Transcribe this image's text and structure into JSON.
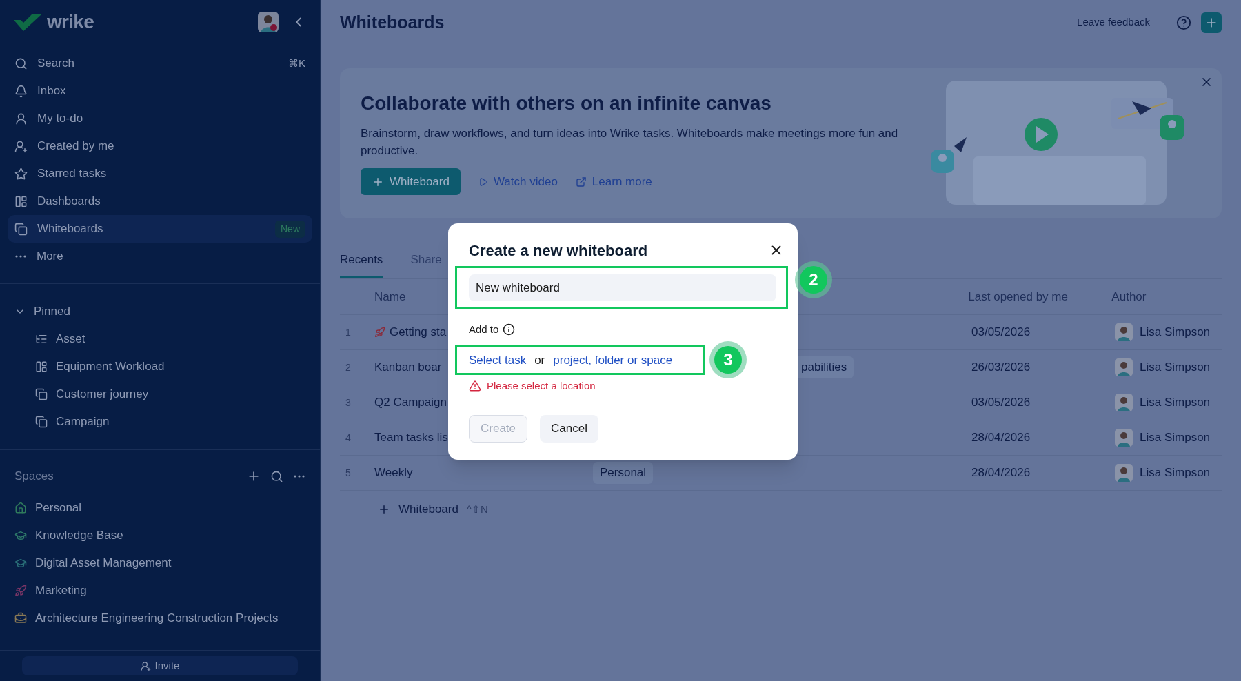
{
  "sidebar": {
    "logo": "wrike",
    "nav": [
      {
        "label": "Search",
        "shortcut": "⌘K",
        "selected": false
      },
      {
        "label": "Inbox",
        "selected": false
      },
      {
        "label": "My to-do",
        "selected": false
      },
      {
        "label": "Created by me",
        "selected": false
      },
      {
        "label": "Starred tasks",
        "selected": false
      },
      {
        "label": "Dashboards",
        "selected": false
      },
      {
        "label": "Whiteboards",
        "badge": "New",
        "selected": true
      },
      {
        "label": "More",
        "selected": false
      }
    ],
    "pinned": {
      "title": "Pinned",
      "expanded": true,
      "items": [
        {
          "label": "Asset"
        },
        {
          "label": "Equipment Workload"
        },
        {
          "label": "Customer journey"
        },
        {
          "label": "Campaign"
        }
      ]
    },
    "spaces": {
      "title": "Spaces",
      "items": [
        {
          "label": "Personal",
          "color": "#2f7a5c"
        },
        {
          "label": "Knowledge Base",
          "color": "#2f7a6a"
        },
        {
          "label": "Digital Asset Management",
          "color": "#2a6f78"
        },
        {
          "label": "Marketing",
          "color": "#7a3566"
        },
        {
          "label": "Architecture Engineering Construction Projects",
          "color": "#8a7a55"
        }
      ]
    },
    "invite": "Invite"
  },
  "header": {
    "title": "Whiteboards",
    "feedback": "Leave feedback"
  },
  "banner": {
    "title": "Collaborate with others on an infinite canvas",
    "text": "Brainstorm, draw workflows, and turn ideas into Wrike tasks. Whiteboards make meetings more fun and productive.",
    "primary_button": "Whiteboard",
    "links": [
      {
        "kind": "video",
        "label": "Watch video"
      },
      {
        "kind": "external",
        "label": "Learn more"
      }
    ]
  },
  "tabs": [
    {
      "label": "Recents",
      "selected": true
    },
    {
      "label": "Share",
      "selected": false
    }
  ],
  "table": {
    "columns": [
      "Name",
      "Last opened by me",
      "Author"
    ],
    "rows": [
      {
        "number": "1",
        "name": "Getting sta",
        "last_opened": "03/05/2026",
        "author": "Lisa Simpson"
      },
      {
        "number": "2",
        "name": "Kanban boar",
        "tag": "pabilities",
        "last_opened": "26/03/2026",
        "author": "Lisa Simpson"
      },
      {
        "number": "3",
        "name": "Q2 Campaign",
        "last_opened": "03/05/2026",
        "author": "Lisa Simpson"
      },
      {
        "number": "4",
        "name": "Team tasks lis",
        "last_opened": "28/04/2026",
        "author": "Lisa Simpson"
      },
      {
        "number": "5",
        "name": "Weekly",
        "tag": "Personal",
        "last_opened": "28/04/2026",
        "author": "Lisa Simpson"
      }
    ]
  },
  "add_row": {
    "label": "Whiteboard",
    "shortcut": "^⇧N"
  },
  "dialog": {
    "title": "Create a new whiteboard",
    "name_value": "New whiteboard",
    "add_to_label": "Add to",
    "select_task": "Select task",
    "or": "or",
    "location_link": "project, folder or space",
    "error": "Please select a location",
    "buttons": [
      {
        "label": "Create",
        "disabled": true
      },
      {
        "label": "Cancel",
        "disabled": false
      }
    ]
  },
  "annotations": [
    {
      "number": "2"
    },
    {
      "number": "3"
    }
  ]
}
